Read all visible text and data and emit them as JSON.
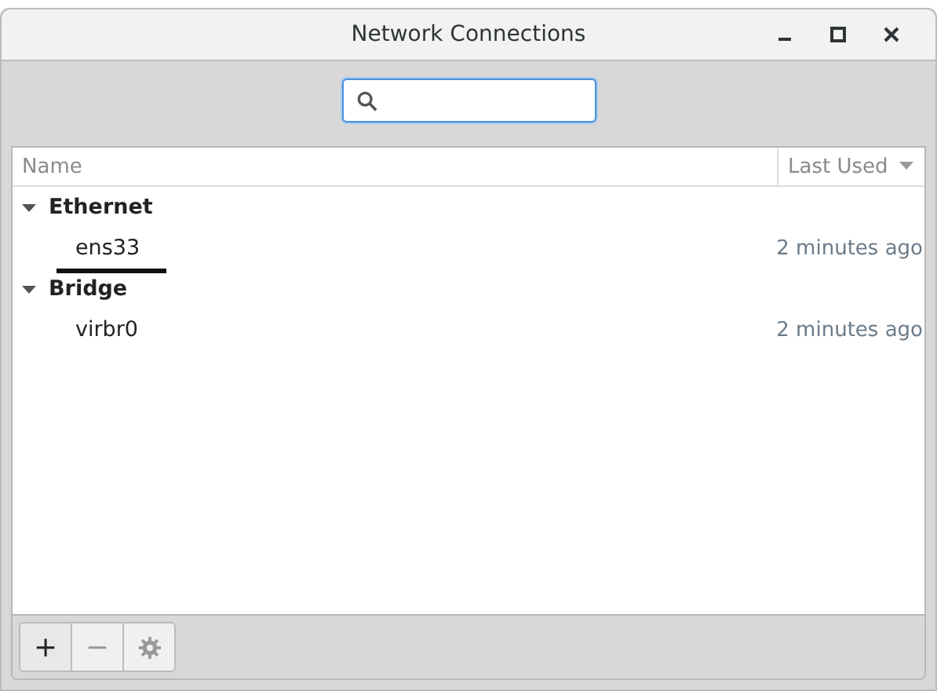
{
  "window": {
    "title": "Network Connections"
  },
  "table": {
    "columns": [
      {
        "label": "Name",
        "sorted": false
      },
      {
        "label": "Last Used",
        "sorted": true
      }
    ],
    "groups": [
      {
        "name": "Ethernet",
        "expanded": true,
        "children": [
          {
            "name": "ens33",
            "last_used": "2 minutes ago",
            "underlined": true
          }
        ]
      },
      {
        "name": "Bridge",
        "expanded": true,
        "children": [
          {
            "name": "virbr0",
            "last_used": "2 minutes ago",
            "underlined": false
          }
        ]
      }
    ]
  },
  "toolbar": [
    {
      "kind": "text",
      "label": "+",
      "disabled": false
    },
    {
      "kind": "text",
      "label": "−",
      "disabled": true
    },
    {
      "kind": "gear",
      "disabled": true
    }
  ]
}
